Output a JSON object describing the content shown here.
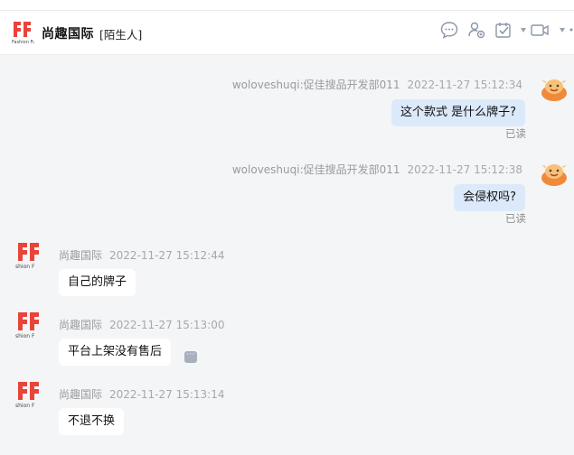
{
  "header": {
    "title": "尚趣国际",
    "tag": "[陌生人]"
  },
  "toolbar": {
    "icons": [
      "chat-bubble-icon",
      "user-settings-icon",
      "task-check-icon",
      "video-call-icon",
      "more-icon"
    ]
  },
  "colors": {
    "outgoing_bubble": "#dce9fb",
    "incoming_bubble": "#ffffff",
    "brand_red": "#e8443a",
    "background": "#f4f5f7"
  },
  "messages": [
    {
      "direction": "out",
      "sender": "woloveshuqi:促佳搜品开发部011",
      "time": "2022-11-27 15:12:34",
      "text": "这个款式  是什么牌子?",
      "status": "已读"
    },
    {
      "direction": "out",
      "sender": "woloveshuqi:促佳搜品开发部011",
      "time": "2022-11-27 15:12:38",
      "text": "会侵权吗?",
      "status": "已读"
    },
    {
      "direction": "in",
      "sender": "尚趣国际",
      "time": "2022-11-27 15:12:44",
      "text": "自己的牌子"
    },
    {
      "direction": "in",
      "sender": "尚趣国际",
      "time": "2022-11-27 15:13:00",
      "text": "平台上架没有售后"
    },
    {
      "direction": "in",
      "sender": "尚趣国际",
      "time": "2022-11-27 15:13:14",
      "text": "不退不换"
    }
  ]
}
